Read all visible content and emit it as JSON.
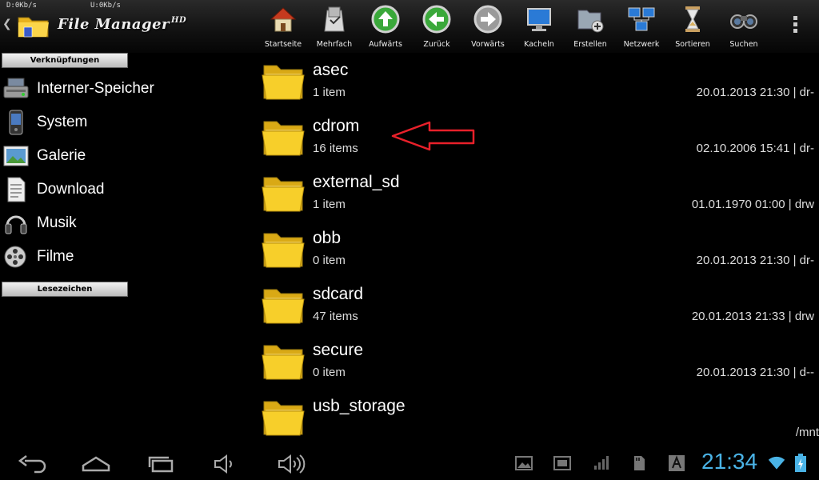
{
  "status": {
    "download_speed": "D:0Kb/s",
    "upload_speed": "U:0Kb/s"
  },
  "app": {
    "title": "File Manager",
    "title_badge": "HD"
  },
  "toolbar": [
    {
      "label": "Startseite",
      "icon": "home-icon"
    },
    {
      "label": "Mehrfach",
      "icon": "multi-select-icon"
    },
    {
      "label": "Aufwärts",
      "icon": "up-icon"
    },
    {
      "label": "Zurück",
      "icon": "back-icon"
    },
    {
      "label": "Vorwärts",
      "icon": "forward-icon"
    },
    {
      "label": "Kacheln",
      "icon": "tiles-icon"
    },
    {
      "label": "Erstellen",
      "icon": "create-folder-icon"
    },
    {
      "label": "Netzwerk",
      "icon": "network-icon"
    },
    {
      "label": "Sortieren",
      "icon": "sort-icon"
    },
    {
      "label": "Suchen",
      "icon": "search-icon"
    }
  ],
  "sidebar": {
    "shortcuts_header": "Verknüpfungen",
    "items": [
      {
        "label": "Interner-Speicher",
        "icon": "internal-storage-icon"
      },
      {
        "label": "System",
        "icon": "phone-icon"
      },
      {
        "label": "Galerie",
        "icon": "gallery-icon"
      },
      {
        "label": "Download",
        "icon": "download-icon"
      },
      {
        "label": "Musik",
        "icon": "headphones-icon"
      },
      {
        "label": "Filme",
        "icon": "film-reel-icon"
      }
    ],
    "bookmarks_header": "Lesezeichen"
  },
  "files": [
    {
      "name": "asec",
      "count": "1 item",
      "meta": "20.01.2013 21:30 | dr-"
    },
    {
      "name": "cdrom",
      "count": "16 items",
      "meta": "02.10.2006 15:41 | dr-"
    },
    {
      "name": "external_sd",
      "count": "1 item",
      "meta": "01.01.1970 01:00 | drw"
    },
    {
      "name": "obb",
      "count": "0 item",
      "meta": "20.01.2013 21:30 | dr-"
    },
    {
      "name": "sdcard",
      "count": "47 items",
      "meta": "20.01.2013 21:33 | drw"
    },
    {
      "name": "secure",
      "count": "0 item",
      "meta": "20.01.2013 21:30 | d--"
    },
    {
      "name": "usb_storage",
      "count": "",
      "meta": ""
    }
  ],
  "current_path": "/mnt",
  "system_bar": {
    "clock": "21:34"
  },
  "colors": {
    "folder": "#f7cf2a",
    "clock": "#4ab3e6",
    "annotation": "#e8202a"
  }
}
